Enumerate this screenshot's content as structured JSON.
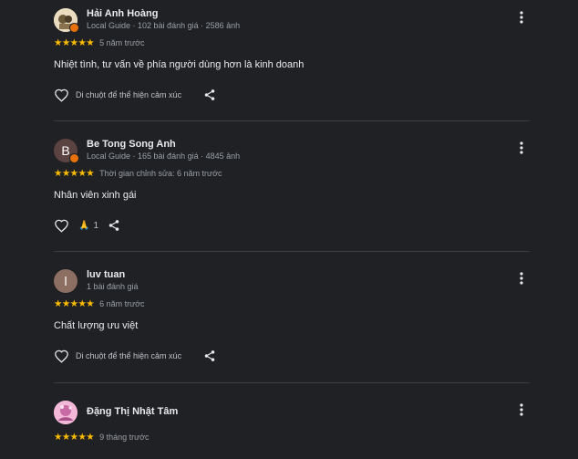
{
  "reviews": [
    {
      "avatar_initial": "",
      "avatar_color": "#e8d6b0",
      "has_badge": true,
      "name": "Hải Anh Hoàng",
      "meta": "Local Guide · 102 bài đánh giá · 2586 ảnh",
      "stars": "★★★★★",
      "rating": 5,
      "when": "5 năm trước",
      "text": "Nhiệt tình, tư vấn về phía người dùng hơn là kinh doanh",
      "react_hint": "Di chuột để thể hiện cảm xúc",
      "reaction_emoji": "",
      "reaction_count": ""
    },
    {
      "avatar_initial": "B",
      "avatar_color": "#5b4342",
      "has_badge": true,
      "name": "Be Tong Song Anh",
      "meta": "Local Guide · 165 bài đánh giá · 4845 ảnh",
      "stars": "★★★★★",
      "rating": 5,
      "when": "Thời gian chỉnh sửa: 6 năm trước",
      "text": "Nhân viên xinh gái",
      "react_hint": "",
      "reaction_emoji": "🙏",
      "reaction_count": "1"
    },
    {
      "avatar_initial": "l",
      "avatar_color": "#8d6e63",
      "has_badge": false,
      "name": "luv tuan",
      "meta": "1 bài đánh giá",
      "stars": "★★★★★",
      "rating": 5,
      "when": "6 năm trước",
      "text": "Chất lượng ưu việt",
      "react_hint": "Di chuột để thể hiện cảm xúc",
      "reaction_emoji": "",
      "reaction_count": ""
    },
    {
      "avatar_initial": "",
      "avatar_color": "#e6a3c9",
      "has_badge": false,
      "name": "Đặng Thị Nhật Tâm",
      "meta": "",
      "stars": "★★★★★",
      "rating": 5,
      "when": "9 tháng trước",
      "text": "",
      "react_hint": "",
      "reaction_emoji": "",
      "reaction_count": ""
    }
  ],
  "colors": {
    "background": "#202124",
    "star": "#fbbc04",
    "divider": "#3c4043",
    "secondary_text": "#9aa0a6"
  },
  "icons": {
    "like": "heart-outline-icon",
    "share": "share-icon",
    "menu": "more-vert-icon"
  }
}
